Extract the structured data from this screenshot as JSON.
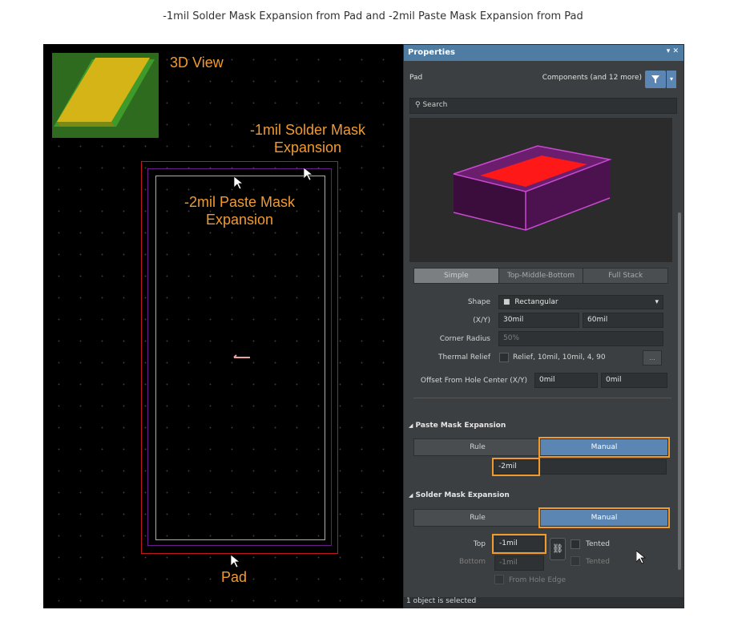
{
  "caption": "-1mil Solder Mask Expansion from Pad and -2mil Paste Mask Expansion from Pad",
  "canvas": {
    "labels": {
      "view3d": "3D View",
      "solder": "-1mil Solder Mask Expansion",
      "paste": "-2mil Paste Mask Expansion",
      "pad": "Pad"
    },
    "pad_designator": "1",
    "colors": {
      "annotation": "#f39b2a",
      "solder_outline": "#c0181a",
      "paste_outline": "#c8c8c8",
      "inner_outline": "#6a1b8a"
    }
  },
  "panel": {
    "title": "Properties",
    "title_controls": "▾ ✕",
    "object": "Pad",
    "filter_label": "Components (and 12 more)",
    "search_placeholder": "Search",
    "tabs": [
      "Simple",
      "Top-Middle-Bottom",
      "Full Stack"
    ],
    "active_tab": "Simple",
    "shape_label": "Shape",
    "shape_value": "Rectangular",
    "xy_label": "(X/Y)",
    "x_value": "30mil",
    "y_value": "60mil",
    "corner_label": "Corner Radius",
    "corner_value": "50%",
    "thermal_label": "Thermal Relief",
    "thermal_value": "Relief, 10mil, 10mil, 4, 90",
    "thermal_more": "...",
    "offset_label": "Offset From Hole Center (X/Y)",
    "offset_x": "0mil",
    "offset_y": "0mil",
    "paste_section": "Paste Mask Expansion",
    "paste_rule": "Rule",
    "paste_manual": "Manual",
    "paste_value": "-2mil",
    "solder_section": "Solder Mask Expansion",
    "solder_rule": "Rule",
    "solder_manual": "Manual",
    "top_label": "Top",
    "top_value": "-1mil",
    "bottom_label": "Bottom",
    "bottom_value": "-1mil",
    "tented_label": "Tented",
    "tented_bottom_label": "Tented",
    "from_hole_edge": "From Hole Edge",
    "status": "1 object is selected"
  }
}
